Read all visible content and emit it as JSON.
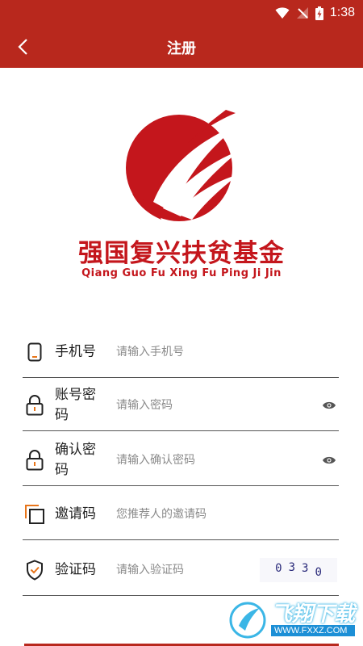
{
  "status_bar": {
    "time": "1:38"
  },
  "app_bar": {
    "title": "注册"
  },
  "brand": {
    "name": "强国复兴扶贫基金",
    "pinyin": "Qiang Guo Fu Xing Fu Ping Ji Jin",
    "color": "#c4161c"
  },
  "form": {
    "phone": {
      "label": "手机号",
      "placeholder": "请输入手机号"
    },
    "password": {
      "label": "账号密码",
      "placeholder": "请输入密码"
    },
    "confirm": {
      "label": "确认密码",
      "placeholder": "请输入确认密码"
    },
    "invite": {
      "label": "邀请码",
      "placeholder": "您推荐人的邀请码"
    },
    "captcha": {
      "label": "验证码",
      "placeholder": "请输入验证码",
      "code": [
        "0",
        "3",
        "3",
        "0"
      ]
    }
  },
  "watermark": {
    "text": "飞翔下载",
    "url": "WWW.FXXZ.COM"
  },
  "colors": {
    "header": "#b8281d",
    "accent": "#c4161c",
    "icon_accent": "#e8751a"
  }
}
